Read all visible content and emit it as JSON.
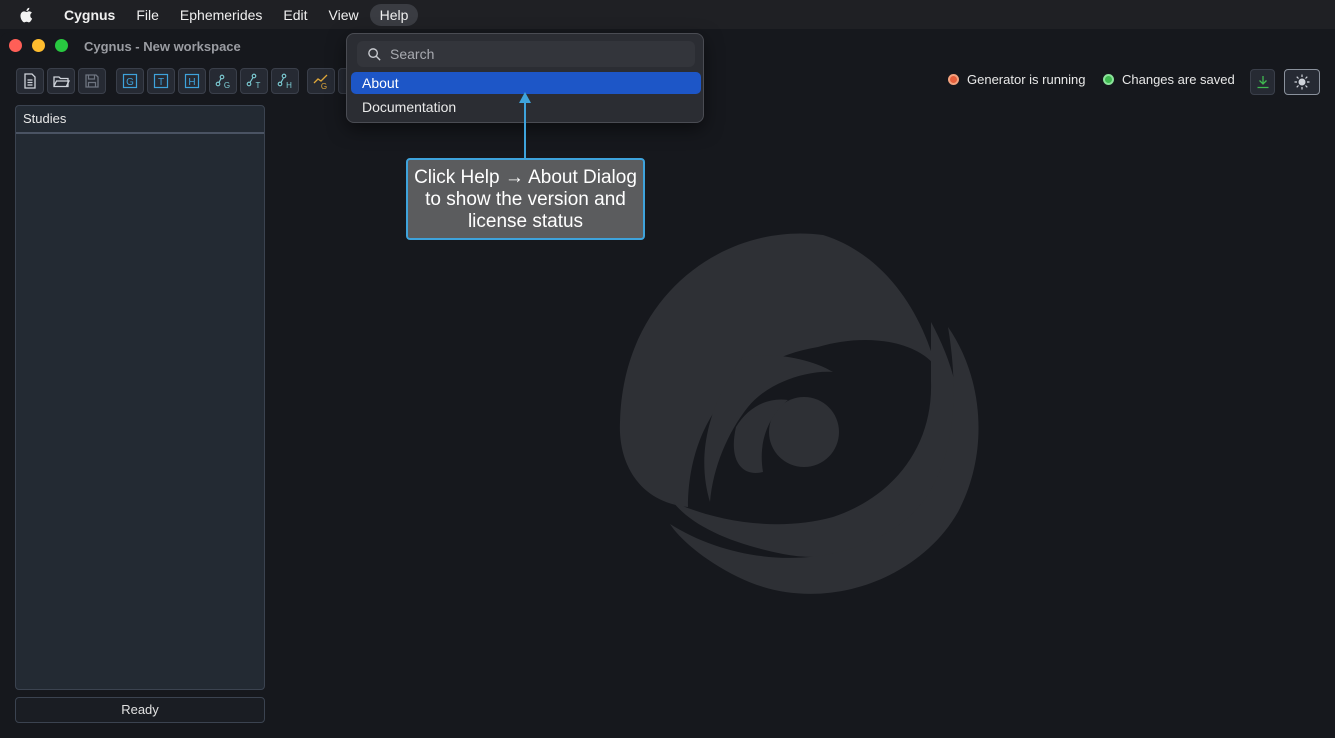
{
  "menubar": {
    "app": "Cygnus",
    "items": [
      "File",
      "Ephemerides",
      "Edit",
      "View",
      "Help"
    ],
    "active": "Help"
  },
  "window": {
    "title": "Cygnus - New workspace"
  },
  "toolbar": {
    "buttons": [
      "new-document-icon",
      "open-folder-icon",
      "save-icon",
      "g-letter-icon",
      "t-letter-icon",
      "h-letter-icon",
      "chart-g-icon",
      "chart-t-icon",
      "chart-h-icon",
      "trend-g-icon"
    ],
    "letters": {
      "g": "G",
      "t": "T",
      "h": "H"
    }
  },
  "status": {
    "generator": "Generator is running",
    "generator_color": "#e8603c",
    "changes": "Changes are saved",
    "changes_color": "#3fb950"
  },
  "sidebar": {
    "studies_header": "Studies",
    "status": "Ready"
  },
  "help_menu": {
    "search_placeholder": "Search",
    "items": [
      {
        "label": "About",
        "selected": true
      },
      {
        "label": "Documentation",
        "selected": false
      }
    ]
  },
  "annotation": {
    "text_lines": [
      "Click Help → About Dialog",
      "to show the version and",
      "license status"
    ]
  },
  "colors": {
    "accent": "#1d56c7",
    "annotation": "#3ea3dc"
  }
}
